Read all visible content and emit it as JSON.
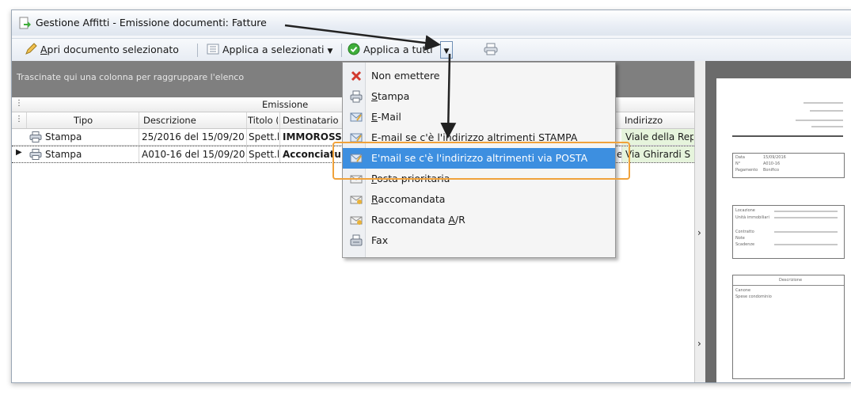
{
  "window": {
    "title": "Gestione Affitti - Emissione documenti: Fatture"
  },
  "toolbar": {
    "open_label_ul": "A",
    "open_label_rest": "pri documento selezionato",
    "apply_selected_label": "Applica a selezionati",
    "apply_all_label": "Applica a tutti"
  },
  "grid": {
    "group_hint": "Trascinate qui una colonna per raggruppare l'elenco",
    "band_header": "Emissione",
    "columns": {
      "tipo": "Tipo",
      "descrizione": "Descrizione",
      "titolo": "Titolo (",
      "destinatario": "Destinatario",
      "indirizzo": "Indirizzo"
    },
    "rows": [
      {
        "tipo": "Stampa",
        "descrizione": "25/2016 del 15/09/20",
        "titolo": "Spett.l",
        "destinatario": "IMMOROSS",
        "indirizzo": "Viale della Republ"
      },
      {
        "tipo": "Stampa",
        "descrizione": "A010-16 del 15/09/20",
        "titolo": "Spett.l",
        "destinatario": "Acconciatu",
        "indirizzo_prefix": "e",
        "indirizzo": "Via Ghirardi S"
      }
    ]
  },
  "menu": {
    "items": [
      {
        "label": "Non emettere",
        "icon": "red-x-icon"
      },
      {
        "label_ul": "S",
        "label": "tampa",
        "icon": "printer-icon"
      },
      {
        "label_ul": "E",
        "label": "-Mail",
        "icon": "email-icon"
      },
      {
        "label": "E-mail se c'è l'indirizzo altrimenti STAMPA",
        "icon": "email-icon"
      },
      {
        "label": "E'mail se c'è l'indirizzo altrimenti via POSTA",
        "icon": "email-icon",
        "selected": true
      },
      {
        "label_ul": "P",
        "label": "osta prioritaria",
        "icon": "letter-icon"
      },
      {
        "label_ul": "R",
        "label": "accomandata",
        "icon": "letter-icon"
      },
      {
        "label": "Raccomandata ",
        "label_ul2": "A",
        "label_tail": "/R",
        "icon": "letter-icon"
      },
      {
        "label": "Fax",
        "icon": "fax-icon"
      }
    ]
  },
  "preview": {
    "lines": [
      "Data",
      "N°",
      "Pagamento",
      "Locazione",
      "Unità immobiliari",
      "Contratto",
      "Note",
      "Scadenze",
      "Descrizione",
      "Canone",
      "Spese condominio"
    ],
    "values": [
      "15/09/2016",
      "A010-16",
      "Bonifico"
    ]
  },
  "colors": {
    "selected_item": "#3d8fe0",
    "highlight_box": "#f0a23b",
    "group_bar": "#7f7f7f",
    "row_green": "#e6f4dc"
  }
}
